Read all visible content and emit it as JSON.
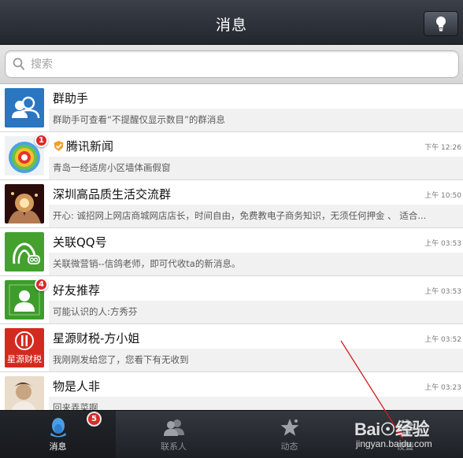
{
  "header": {
    "title": "消息"
  },
  "search": {
    "placeholder": "搜索"
  },
  "conversations": [
    {
      "name": "群助手",
      "preview": "群助手可查看“不提醒仅显示数目”的群消息",
      "time": "",
      "badge": ""
    },
    {
      "name": "腾讯新闻",
      "preview": "青岛一经适房小区墙体画假窗",
      "time": "下午 12:26",
      "badge": "1"
    },
    {
      "name": "深圳高品质生活交流群",
      "preview": "开心: 诚招网上网店商城网店店长，时间自由，免费教电子商务知识，无须任何押金 、 适合...",
      "time": "上午 10:50",
      "badge": ""
    },
    {
      "name": "关联QQ号",
      "preview": "关联微营销--信鸽老师，即可代收ta的新消息。",
      "time": "上午 03:53",
      "badge": ""
    },
    {
      "name": "好友推荐",
      "preview": "可能认识的人:方秀芬",
      "time": "上午 03:53",
      "badge": "4"
    },
    {
      "name": "星源财税-方小姐",
      "preview": "我刚刚发给您了，您看下有无收到",
      "time": "上午 03:52",
      "badge": ""
    },
    {
      "name": "物是人非",
      "preview": "回来弄菜啊",
      "time": "上午 03:23",
      "badge": ""
    }
  ],
  "avatar_labels": {
    "xingyuan": "星源财税"
  },
  "tabs": [
    {
      "label": "消息",
      "icon": "qq-penguin-icon",
      "badge": "5"
    },
    {
      "label": "联系人",
      "icon": "contacts-icon"
    },
    {
      "label": "动态",
      "icon": "star-icon"
    },
    {
      "label": "设置",
      "icon": "settings-icon"
    }
  ],
  "watermark": {
    "logo": "Bai☉经验",
    "url": "jingyan.baidu.com"
  },
  "colors": {
    "header": "#2b2f36",
    "badge": "#d72b2b",
    "tabbar": "#26292f"
  }
}
